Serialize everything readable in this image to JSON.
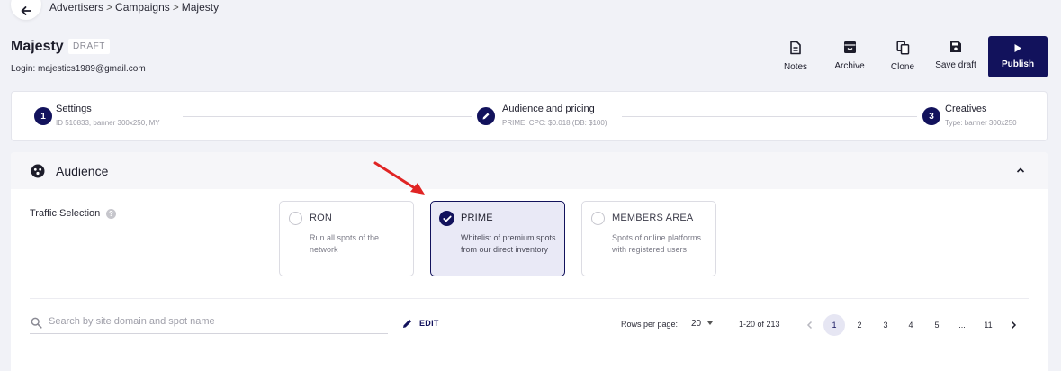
{
  "breadcrumb": [
    "Advertisers",
    "Campaigns",
    "Majesty"
  ],
  "breadcrumb_sep": ">",
  "campaign": {
    "title": "Majesty",
    "status": "DRAFT",
    "login": "Login: majestics1989@gmail.com"
  },
  "toolbar": {
    "notes": "Notes",
    "archive": "Archive",
    "clone": "Clone",
    "save_draft": "Save draft",
    "publish": "Publish"
  },
  "steps": [
    {
      "number": "1",
      "title": "Settings",
      "subtitle": "ID 510833, banner 300x250, MY"
    },
    {
      "number": "",
      "title": "Audience and pricing",
      "subtitle": "PRIME, CPC: $0.018 (DB: $100)"
    },
    {
      "number": "3",
      "title": "Creatives",
      "subtitle": "Type: banner 300x250"
    }
  ],
  "audience": {
    "title": "Audience",
    "traffic_label": "Traffic Selection",
    "help_glyph": "?",
    "options": [
      {
        "title": "RON",
        "desc": "Run all spots of the network",
        "selected": false
      },
      {
        "title": "PRIME",
        "desc": "Whitelist of premium spots from our direct inventory",
        "selected": true
      },
      {
        "title": "MEMBERS AREA",
        "desc": "Spots of online platforms with registered users",
        "selected": false
      }
    ]
  },
  "table_controls": {
    "search_placeholder": "Search by site domain and spot name",
    "search_value": "",
    "edit": "EDIT",
    "rows_per_page_label": "Rows per page:",
    "rows_per_page": "20",
    "range": "1-20 of 213",
    "pages": [
      "1",
      "2",
      "3",
      "4",
      "5",
      "...",
      "11"
    ],
    "current_page": "1"
  },
  "colors": {
    "accent": "#12125c",
    "background": "#f1f2f7",
    "selected_card": "#e9e9f6",
    "annotation_arrow": "#e02424"
  }
}
